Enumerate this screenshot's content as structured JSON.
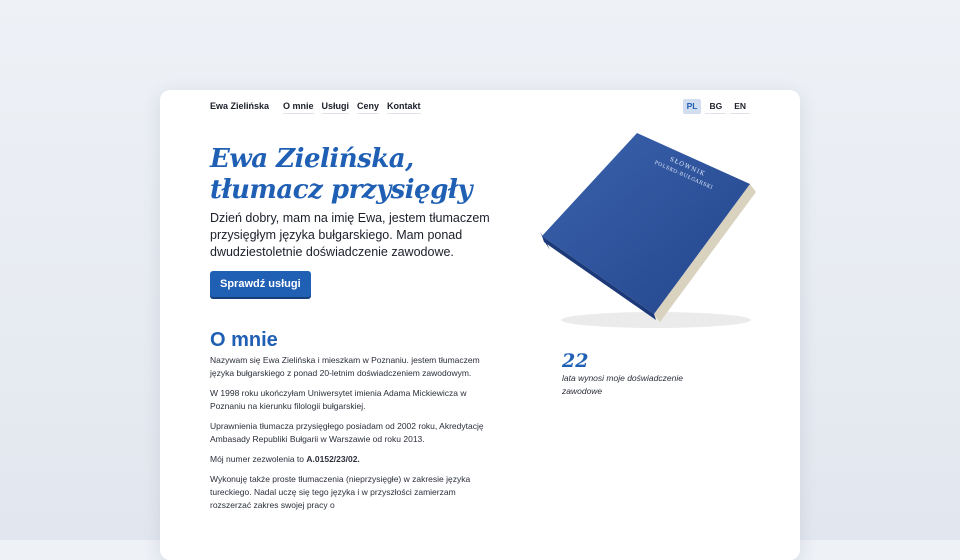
{
  "nav": {
    "brand": "Ewa Zielińska",
    "links": [
      "O mnie",
      "Usługi",
      "Ceny",
      "Kontakt"
    ],
    "languages": [
      "PL",
      "BG",
      "EN"
    ],
    "active_language": "PL"
  },
  "hero": {
    "title_line1": "Ewa Zielińska,",
    "title_line2": "tłumacz przysięgły",
    "intro": "Dzień dobry, mam na imię Ewa, jestem tłumaczem przysięgłym języka bułgarskiego. Mam ponad dwudziestoletnie doświadczenie zawodowe.",
    "cta_label": "Sprawdź usługi",
    "book_cover_line1": "SŁOWNIK",
    "book_cover_line2": "POLSKO-BUŁGARSKI"
  },
  "about": {
    "title": "O mnie",
    "p1": "Nazywam się Ewa Zielińska i mieszkam w Poznaniu. jestem tłumaczem języka bułgarskiego z ponad 20-letnim doświadczeniem zawodowym.",
    "p2": "W 1998 roku ukończyłam Uniwersytet imienia Adama Mickiewicza w Poznaniu na kierunku filologii bułgarskiej.",
    "p3": "Uprawnienia tłumacza przysięgłego posiadam od 2002 roku, Akredytację Ambasady Republiki Bułgarii w Warszawie od roku 2013.",
    "p4_prefix": "Mój numer zezwolenia to ",
    "p4_number": "A.0152/23/02.",
    "p5": "Wykonuję także proste tłumaczenia (nieprzysięgłe) w zakresie języka tureckiego. Nadal uczę się tego języka i w przyszłości zamierzam rozszerzać zakres swojej pracy o",
    "stat_number": "22",
    "stat_label": "lata wynosi moje doświadczenie zawodowe"
  },
  "colors": {
    "accent": "#1f5fb4",
    "background": "#e8ecf2",
    "text": "#1b1f2a"
  }
}
